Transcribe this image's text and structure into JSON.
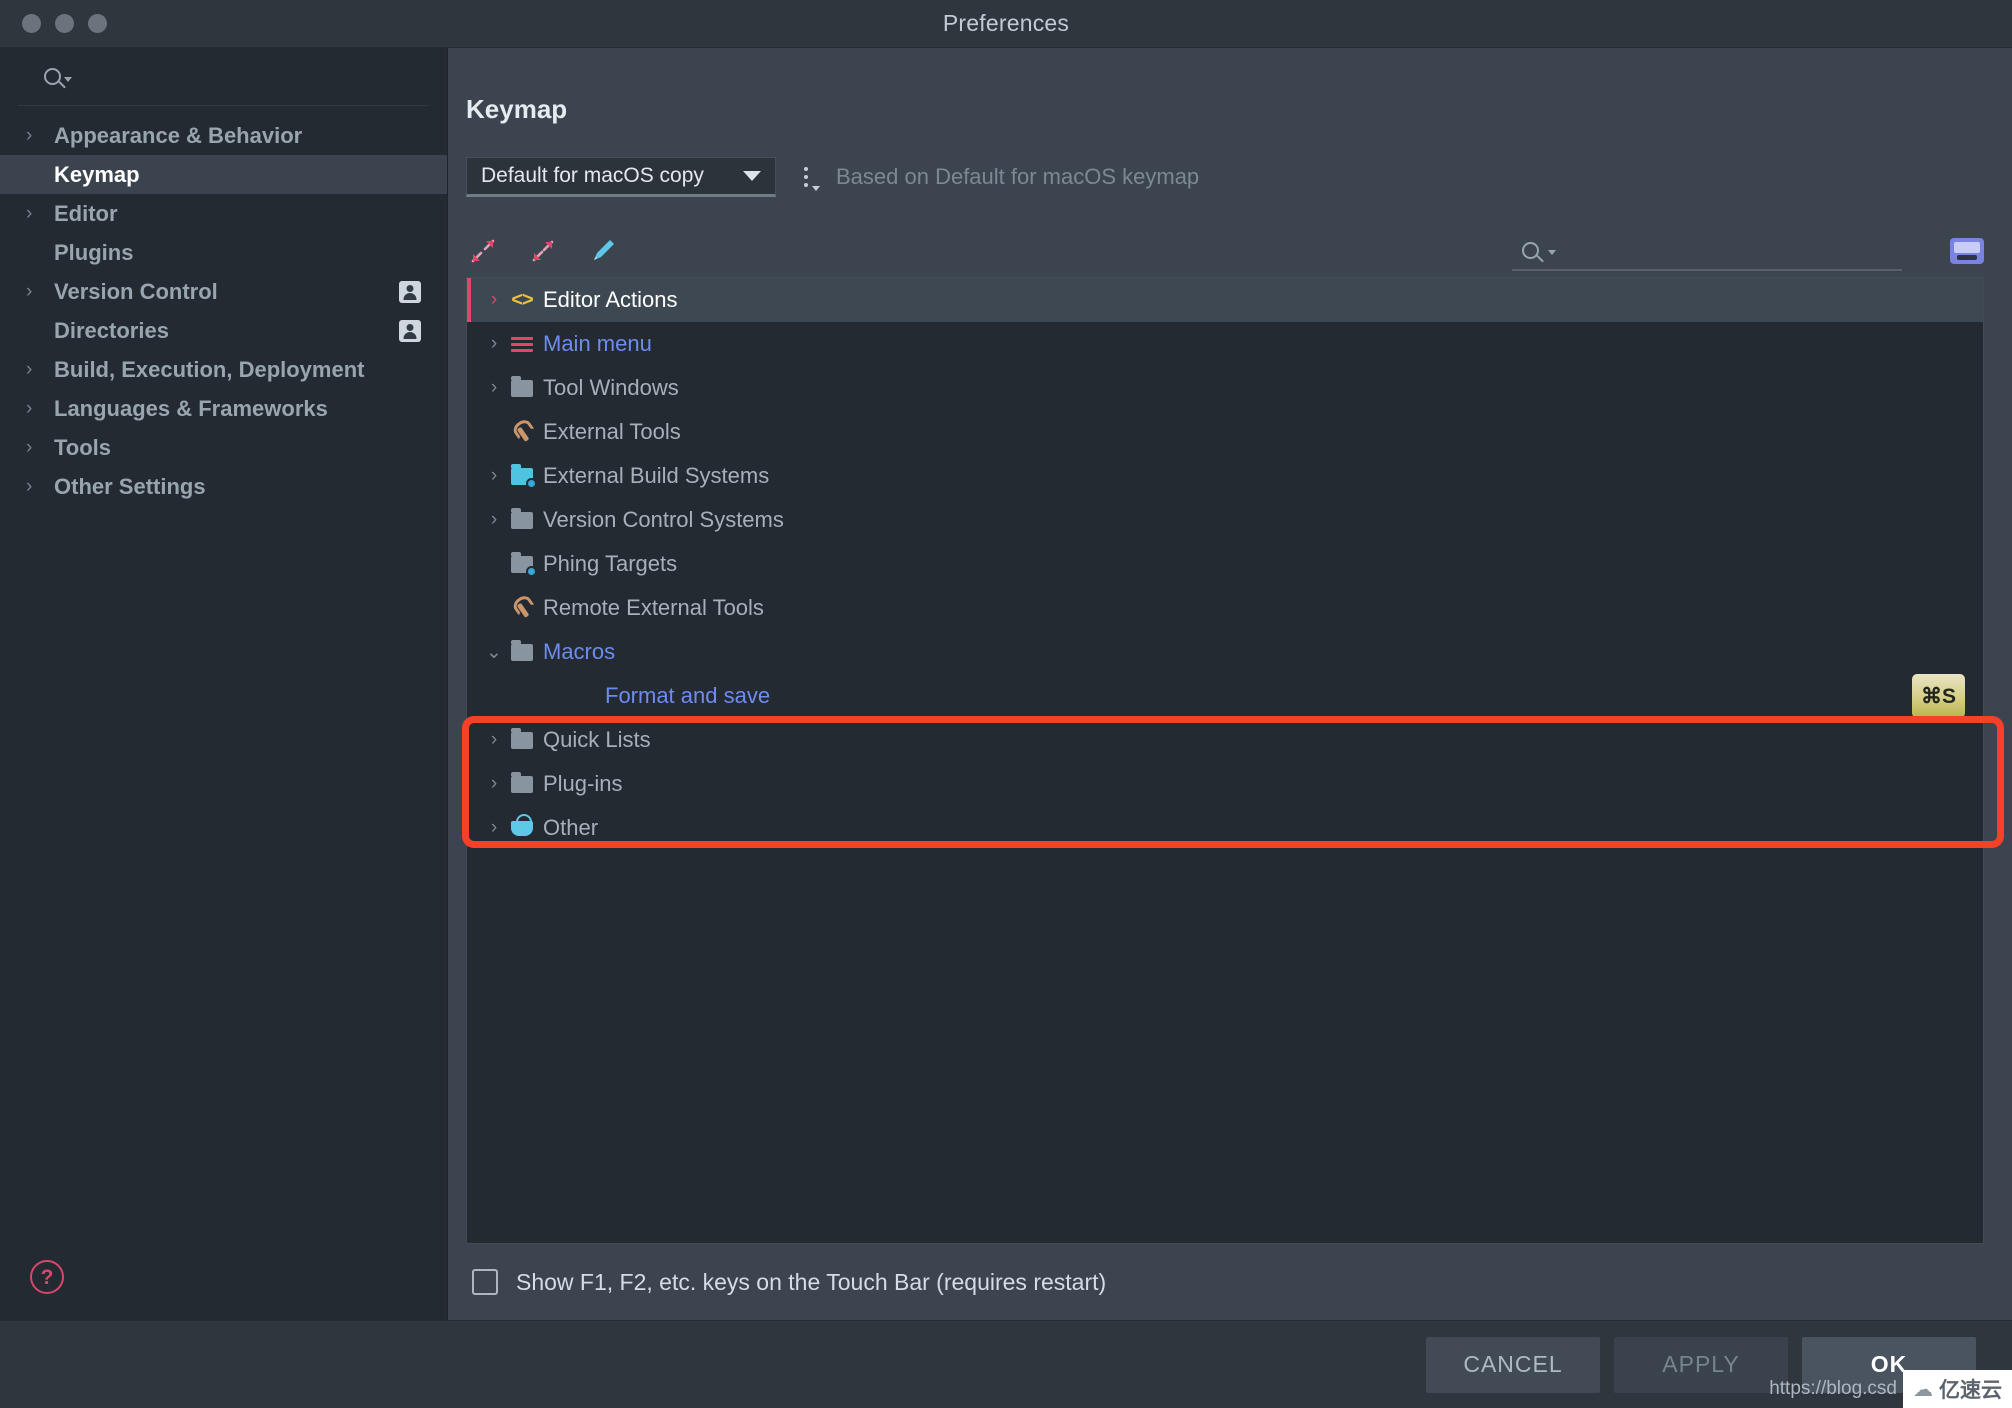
{
  "window": {
    "title": "Preferences",
    "traffic_lights": [
      "close-button",
      "minimize-button",
      "zoom-button"
    ]
  },
  "sidebar": {
    "search_placeholder": "",
    "search_icon": "search-icon",
    "items": [
      {
        "label": "Appearance & Behavior",
        "expandable": true,
        "selected": false,
        "badge": false
      },
      {
        "label": "Keymap",
        "expandable": false,
        "selected": true,
        "badge": false
      },
      {
        "label": "Editor",
        "expandable": true,
        "selected": false,
        "badge": false
      },
      {
        "label": "Plugins",
        "expandable": false,
        "selected": false,
        "badge": false
      },
      {
        "label": "Version Control",
        "expandable": true,
        "selected": false,
        "badge": true
      },
      {
        "label": "Directories",
        "expandable": false,
        "selected": false,
        "badge": true
      },
      {
        "label": "Build, Execution, Deployment",
        "expandable": true,
        "selected": false,
        "badge": false
      },
      {
        "label": "Languages & Frameworks",
        "expandable": true,
        "selected": false,
        "badge": false
      },
      {
        "label": "Tools",
        "expandable": true,
        "selected": false,
        "badge": false
      },
      {
        "label": "Other Settings",
        "expandable": true,
        "selected": false,
        "badge": false
      }
    ],
    "help_glyph": "?"
  },
  "main": {
    "page_title": "Keymap",
    "keymap_select": {
      "value": "Default for macOS copy",
      "caret": "chevron-down-icon"
    },
    "options_button": "more-options-icon",
    "based_on_text": "Based on Default for macOS keymap",
    "toolbar": {
      "expand_all": "expand-all-icon",
      "collapse_all": "collapse-all-icon",
      "edit": "edit-pencil-icon",
      "search_placeholder": "",
      "search_icon": "search-icon",
      "keyboard_layout": "keyboard-icon"
    },
    "tree": [
      {
        "label": "Editor Actions",
        "icon": "code-tag-icon",
        "expandable": true,
        "expanded": false,
        "selected": true,
        "style": "white",
        "indent": 0,
        "shortcut": ""
      },
      {
        "label": "Main menu",
        "icon": "hamburger-menu-icon",
        "expandable": true,
        "expanded": false,
        "selected": false,
        "style": "blue",
        "indent": 0,
        "shortcut": ""
      },
      {
        "label": "Tool Windows",
        "icon": "folder-icon",
        "expandable": true,
        "expanded": false,
        "selected": false,
        "style": "normal",
        "indent": 0,
        "shortcut": ""
      },
      {
        "label": "External Tools",
        "icon": "wrench-icon",
        "expandable": false,
        "expanded": false,
        "selected": false,
        "style": "normal",
        "indent": 0,
        "shortcut": ""
      },
      {
        "label": "External Build Systems",
        "icon": "folder-gear-cyan-icon",
        "expandable": true,
        "expanded": false,
        "selected": false,
        "style": "normal",
        "indent": 0,
        "shortcut": ""
      },
      {
        "label": "Version Control Systems",
        "icon": "folder-icon",
        "expandable": true,
        "expanded": false,
        "selected": false,
        "style": "normal",
        "indent": 0,
        "shortcut": ""
      },
      {
        "label": "Phing Targets",
        "icon": "folder-gear-icon",
        "expandable": false,
        "expanded": false,
        "selected": false,
        "style": "normal",
        "indent": 0,
        "shortcut": ""
      },
      {
        "label": "Remote External Tools",
        "icon": "wrench-icon",
        "expandable": false,
        "expanded": false,
        "selected": false,
        "style": "normal",
        "indent": 0,
        "shortcut": ""
      },
      {
        "label": "Macros",
        "icon": "folder-icon",
        "expandable": true,
        "expanded": true,
        "selected": false,
        "style": "blue",
        "indent": 0,
        "shortcut": ""
      },
      {
        "label": "Format and save",
        "icon": "none",
        "expandable": false,
        "expanded": false,
        "selected": false,
        "style": "blue",
        "indent": 1,
        "shortcut": "⌘S"
      },
      {
        "label": "Quick Lists",
        "icon": "folder-icon",
        "expandable": true,
        "expanded": false,
        "selected": false,
        "style": "normal",
        "indent": 0,
        "shortcut": ""
      },
      {
        "label": "Plug-ins",
        "icon": "folder-icon",
        "expandable": true,
        "expanded": false,
        "selected": false,
        "style": "normal",
        "indent": 0,
        "shortcut": ""
      },
      {
        "label": "Other",
        "icon": "basket-icon",
        "expandable": true,
        "expanded": false,
        "selected": false,
        "style": "normal",
        "indent": 0,
        "shortcut": ""
      }
    ],
    "touchbar_checkbox": {
      "label": "Show F1, F2, etc. keys on the Touch Bar (requires restart)",
      "checked": false
    }
  },
  "footer": {
    "cancel_label": "CANCEL",
    "apply_label": "APPLY",
    "ok_label": "OK"
  },
  "watermark": {
    "url": "https://blog.csd",
    "brand": "亿速云",
    "cloud_icon": "cloud-icon"
  },
  "colors": {
    "accent_red": "#e0476b",
    "annotation_red": "#f6402a",
    "link_blue": "#6e8cf0",
    "shortcut_badge": "#d4cf86"
  }
}
